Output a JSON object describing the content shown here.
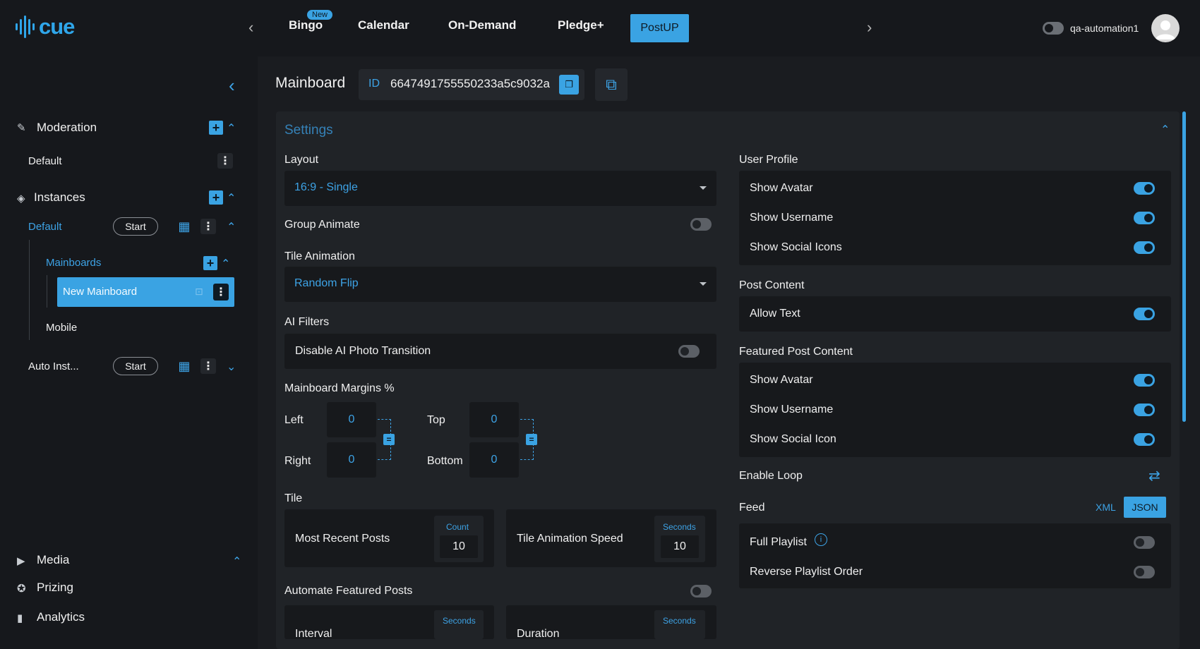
{
  "app": {
    "logo_text": "cue"
  },
  "nav": {
    "tabs": [
      {
        "label": "Bingo",
        "badge": "New"
      },
      {
        "label": "Calendar"
      },
      {
        "label": "On-Demand"
      },
      {
        "label": "Pledge+"
      },
      {
        "label": "PostUP",
        "active": true
      }
    ]
  },
  "user": {
    "name": "qa-automation1"
  },
  "sidebar": {
    "moderation": {
      "label": "Moderation",
      "item": "Default"
    },
    "instances": {
      "label": "Instances",
      "default": {
        "label": "Default",
        "start": "Start"
      },
      "mainboards": {
        "label": "Mainboards",
        "selected": "New Mainboard"
      },
      "mobile": "Mobile",
      "auto": {
        "label": "Auto Inst...",
        "start": "Start"
      }
    },
    "bottom": {
      "media": "Media",
      "prizing": "Prizing",
      "analytics": "Analytics"
    }
  },
  "header": {
    "title": "Mainboard",
    "id_label": "ID",
    "id_value": "6647491755550233a5c9032a"
  },
  "settings": {
    "title": "Settings",
    "layout": {
      "label": "Layout",
      "value": "16:9 - Single"
    },
    "group_animate": {
      "label": "Group Animate",
      "on": false
    },
    "tile_animation": {
      "label": "Tile Animation",
      "value": "Random Flip"
    },
    "ai_filters": {
      "label": "AI Filters",
      "disable_transition": "Disable AI Photo Transition",
      "on": false
    },
    "margins": {
      "label": "Mainboard Margins %",
      "left": {
        "label": "Left",
        "value": "0"
      },
      "right": {
        "label": "Right",
        "value": "0"
      },
      "top": {
        "label": "Top",
        "value": "0"
      },
      "bottom": {
        "label": "Bottom",
        "value": "0"
      }
    },
    "tile": {
      "label": "Tile",
      "recent": {
        "label": "Most Recent Posts",
        "unit": "Count",
        "value": "10"
      },
      "speed": {
        "label": "Tile Animation Speed",
        "unit": "Seconds",
        "value": "10"
      }
    },
    "automate": {
      "label": "Automate Featured Posts",
      "on": false,
      "interval": {
        "label": "Interval",
        "unit": "Seconds"
      },
      "duration": {
        "label": "Duration",
        "unit": "Seconds"
      }
    },
    "user_profile": {
      "label": "User Profile",
      "items": [
        {
          "label": "Show Avatar",
          "on": true
        },
        {
          "label": "Show Username",
          "on": true
        },
        {
          "label": "Show Social Icons",
          "on": true
        }
      ]
    },
    "post_content": {
      "label": "Post Content",
      "items": [
        {
          "label": "Allow Text",
          "on": true
        }
      ]
    },
    "featured_content": {
      "label": "Featured Post Content",
      "items": [
        {
          "label": "Show Avatar",
          "on": true
        },
        {
          "label": "Show Username",
          "on": true
        },
        {
          "label": "Show Social Icon",
          "on": true
        }
      ]
    },
    "enable_loop": {
      "label": "Enable Loop"
    },
    "feed": {
      "label": "Feed",
      "formats": [
        "XML",
        "JSON"
      ],
      "selected": "JSON",
      "items": [
        {
          "label": "Full Playlist",
          "on": false
        },
        {
          "label": "Reverse Playlist Order",
          "on": false
        }
      ]
    }
  }
}
